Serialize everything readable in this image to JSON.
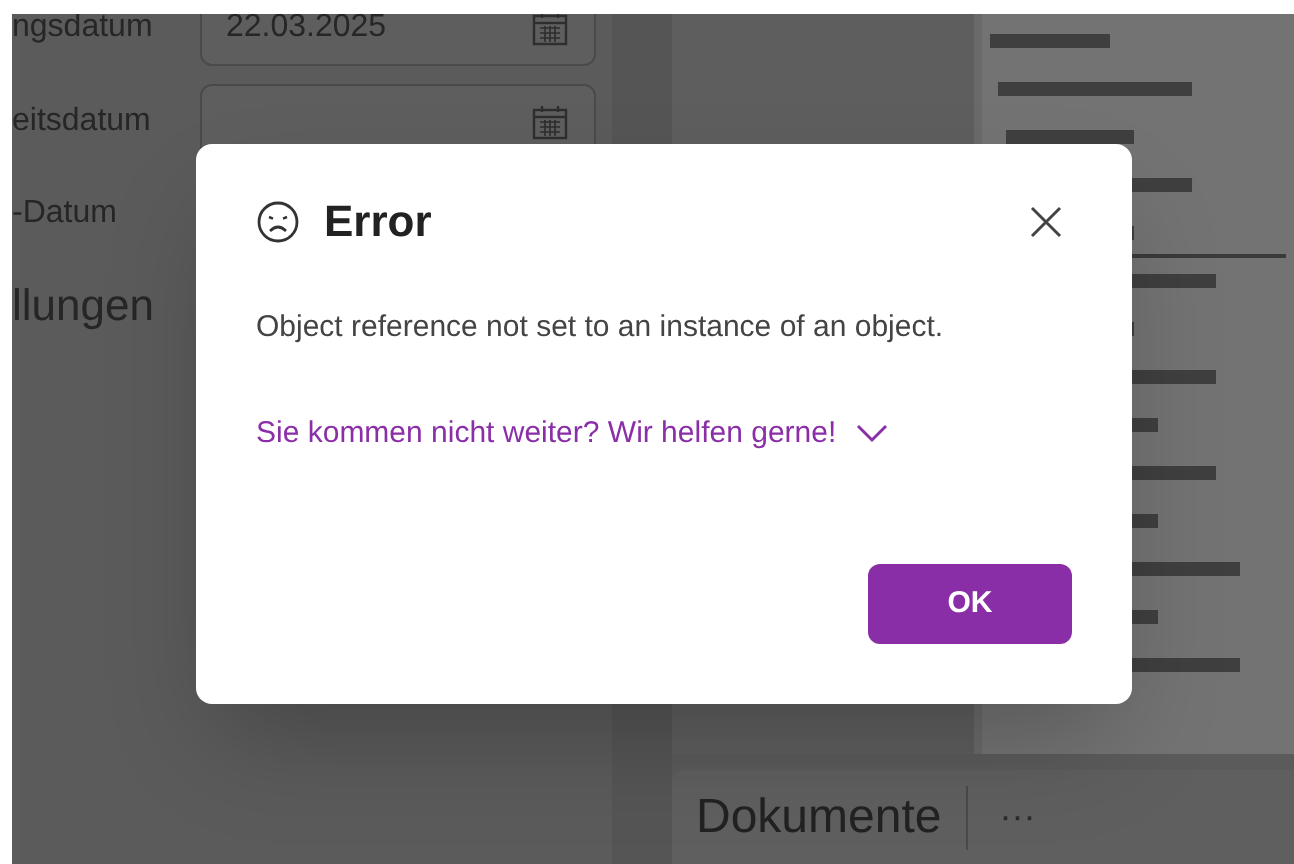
{
  "background": {
    "fields": [
      {
        "label": "ngsdatum",
        "value": "22.03.2025"
      },
      {
        "label": "eitsdatum"
      }
    ],
    "date_label": "-Datum",
    "section_title": "llungen",
    "documents_card": {
      "title": "Dokumente",
      "more": "···"
    }
  },
  "dialog": {
    "title": "Error",
    "message": "Object reference not set to an instance of an object.",
    "help_link": {
      "text": "Sie kommen nicht weiter? Wir helfen gerne!",
      "expanded": false
    },
    "buttons": [
      {
        "label": "OK"
      }
    ]
  }
}
